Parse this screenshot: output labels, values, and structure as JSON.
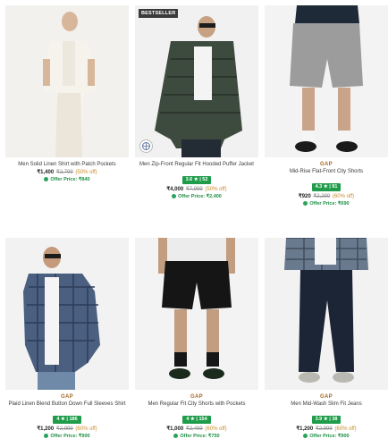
{
  "products": [
    {
      "brand": "",
      "name": "Men Solid Linen Shirt with Patch Pockets",
      "rating": "",
      "price": "₹1,400",
      "mrp": "₹2,799",
      "discount": "(50% off)",
      "offer": "Offer Price: ₹840",
      "badge": "",
      "image_icon": "shirt-photo",
      "colors": {
        "bg": "#f2f1ee",
        "top": "#f4f1ea",
        "bottom": "#efeae1"
      }
    },
    {
      "brand": "",
      "name": "Men Zip-Front Regular Fit Hooded Puffer Jacket",
      "rating": "3.6 ★ | 52",
      "price": "₹4,000",
      "mrp": "₹7,999",
      "discount": "(50% off)",
      "offer": "Offer Price: ₹2,400",
      "badge": "BESTSELLER",
      "image_icon": "jacket-photo",
      "colors": {
        "bg": "#f1f1f1",
        "top": "#3c4a3c",
        "bottom": "#27303a"
      }
    },
    {
      "brand": "GAP",
      "name": "Mid-Rise Flat-Front City Shorts",
      "rating": "4.3 ★ | 91",
      "price": "₹920",
      "mrp": "₹2,299",
      "discount": "(60% off)",
      "offer": "Offer Price: ₹690",
      "badge": "",
      "image_icon": "shorts-photo",
      "colors": {
        "bg": "#f3f3f3",
        "top": "#1f2a38",
        "bottom": "#9a9a9a"
      }
    },
    {
      "brand": "GAP",
      "name": "Plaid Linen Blend Button Down Full Sleeves Shirt",
      "rating": "4 ★ | 186",
      "price": "₹1,200",
      "mrp": "₹2,999",
      "discount": "(60% off)",
      "offer": "Offer Price: ₹900",
      "badge": "",
      "image_icon": "plaid-shirt-photo",
      "colors": {
        "bg": "#f2f2f2",
        "top": "#4b5f80",
        "bottom": "#2d3d5a"
      }
    },
    {
      "brand": "GAP",
      "name": "Men Regular Fit City Shorts with Pockets",
      "rating": "4 ★ | 154",
      "price": "₹1,000",
      "mrp": "₹2,499",
      "discount": "(60% off)",
      "offer": "Offer Price: ₹750",
      "badge": "",
      "image_icon": "black-shorts-photo",
      "colors": {
        "bg": "#f3f3f3",
        "top": "#e9e9e9",
        "bottom": "#151515"
      }
    },
    {
      "brand": "GAP",
      "name": "Men Mid-Wash Slim Fit Jeans",
      "rating": "3.9 ★ | 38",
      "price": "₹1,200",
      "mrp": "₹2,999",
      "discount": "(60% off)",
      "offer": "Offer Price: ₹900",
      "badge": "",
      "image_icon": "jeans-photo",
      "colors": {
        "bg": "#f2f2f2",
        "top": "#6a7a8e",
        "bottom": "#1c2536"
      }
    }
  ],
  "colors": {
    "rating_bg": "#1f9c4a",
    "brand": "#a46a2b",
    "offer": "#1f8f45",
    "discount": "#c98a2a"
  }
}
